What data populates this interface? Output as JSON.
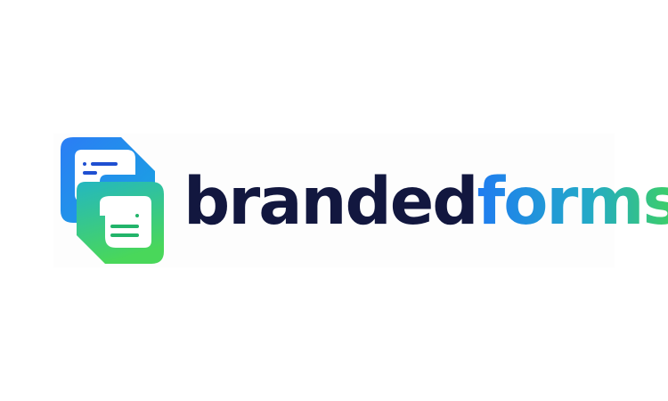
{
  "logo": {
    "icon": "two-overlapping-form-documents-icon",
    "wordmark_part1": "branded",
    "wordmark_part2": "forms",
    "colors": {
      "dark_text": "#12173f",
      "blue": "#1f7cf0",
      "teal": "#23a9c8",
      "green": "#3fd25f"
    }
  }
}
